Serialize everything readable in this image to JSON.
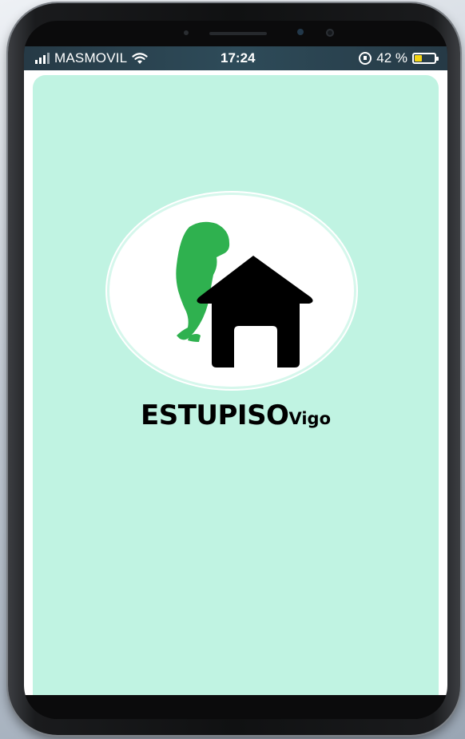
{
  "status_bar": {
    "carrier": "MASMOVIL",
    "time": "17:24",
    "battery_text": "42 %",
    "battery_level": 0.42,
    "icons": [
      "signal-icon",
      "wifi-icon",
      "rotation-lock-icon",
      "battery-icon"
    ]
  },
  "app": {
    "brand_main": "ESTUPISO",
    "brand_sub": "Vigo",
    "background_color": "#c0f3e2",
    "logo_icons": [
      "dinosaur-icon",
      "house-icon"
    ],
    "dinosaur_color": "#2fb14f"
  }
}
